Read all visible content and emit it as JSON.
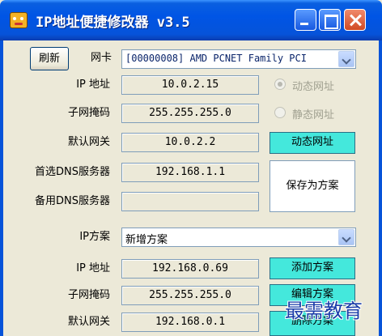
{
  "window": {
    "title": "IP地址便捷修改器 v3.5"
  },
  "adapter": {
    "refresh_label": "刷新",
    "nic_label": "网卡",
    "nic_value": "[00000008] AMD PCNET Family PCI"
  },
  "current": {
    "ip_label": "IP 地址",
    "ip_value": "10.0.2.15",
    "mask_label": "子网掩码",
    "mask_value": "255.255.255.0",
    "gateway_label": "默认网关",
    "gateway_value": "10.0.2.2",
    "dns1_label": "首选DNS服务器",
    "dns1_value": "192.168.1.1",
    "dns2_label": "备用DNS服务器",
    "dns2_value": ""
  },
  "mode": {
    "dynamic_label": "动态网址",
    "static_label": "静态网址",
    "dynamic_button": "动态网址",
    "save_button": "保存为方案"
  },
  "scheme": {
    "label": "IP方案",
    "selected": "新增方案",
    "ip_label": "IP 地址",
    "ip_value": "192.168.0.69",
    "mask_label": "子网掩码",
    "mask_value": "255.255.255.0",
    "gateway_label": "默认网关",
    "gateway_value": "192.168.0.1",
    "add_button": "添加方案",
    "edit_button": "编辑方案",
    "delete_button": "删除方案"
  },
  "watermark": {
    "text": "最需教育"
  },
  "colors": {
    "titlebar": "#0055e5",
    "accent_button": "#44e8dc",
    "background": "#ece9d8"
  }
}
